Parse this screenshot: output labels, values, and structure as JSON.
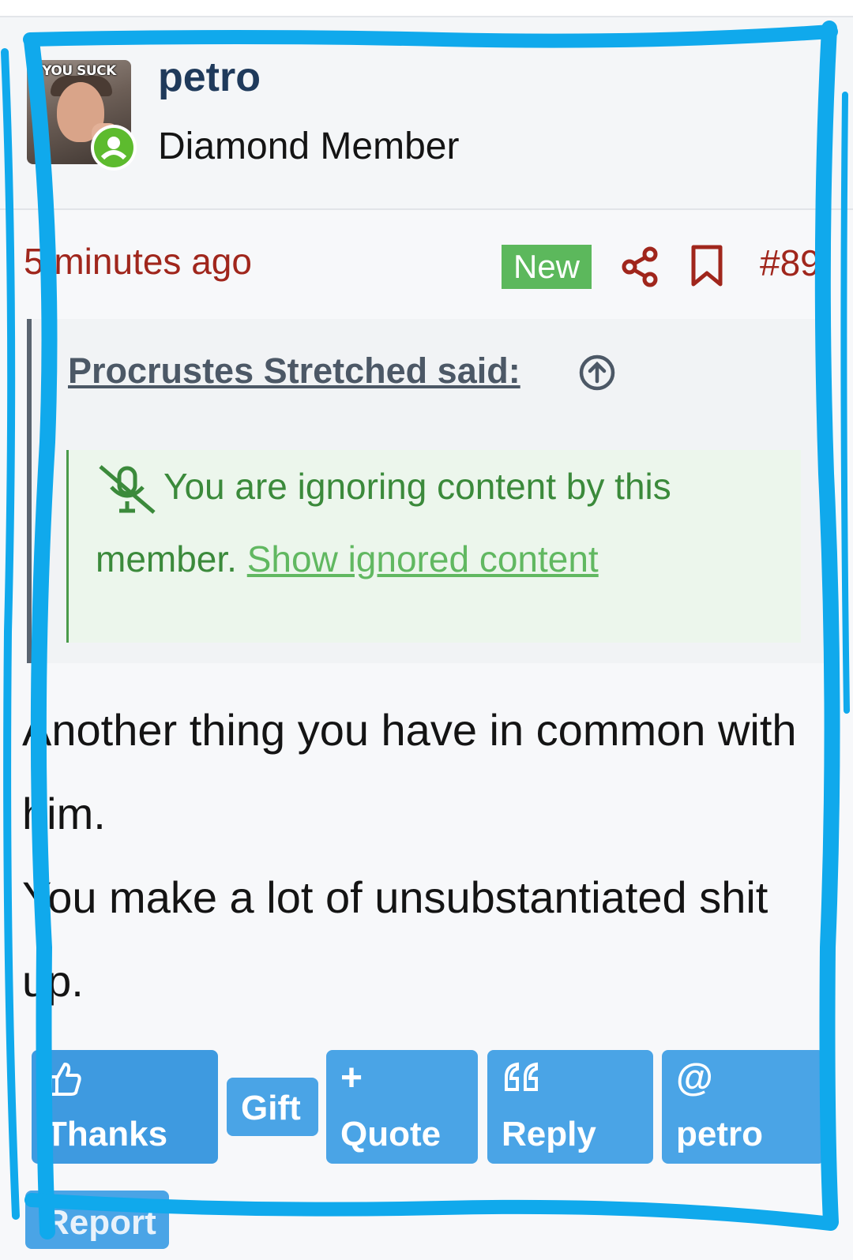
{
  "user": {
    "avatar_caption": "YOU SUCK",
    "name": "petro",
    "title": "Diamond Member"
  },
  "meta": {
    "time": "5 minutes ago",
    "badge": "New",
    "post_number": "#89"
  },
  "quote": {
    "attribution": "Procrustes Stretched said:",
    "ignored_text": "You are ignoring content by this member.",
    "show_link": "Show ignored content"
  },
  "body": {
    "lines": [
      "Another thing you have in common with him.",
      "You make a lot of unsubstantiated shit up."
    ]
  },
  "actions": {
    "thanks": "Thanks",
    "gift": "Gift",
    "quote": "Quote",
    "reply": "Reply",
    "mention": "petro",
    "report": "Report"
  },
  "colors": {
    "accent_red": "#a0261c",
    "button_blue": "#4aa4e6",
    "new_badge": "#5cb85c",
    "annotation_blue": "#10a9ec"
  }
}
